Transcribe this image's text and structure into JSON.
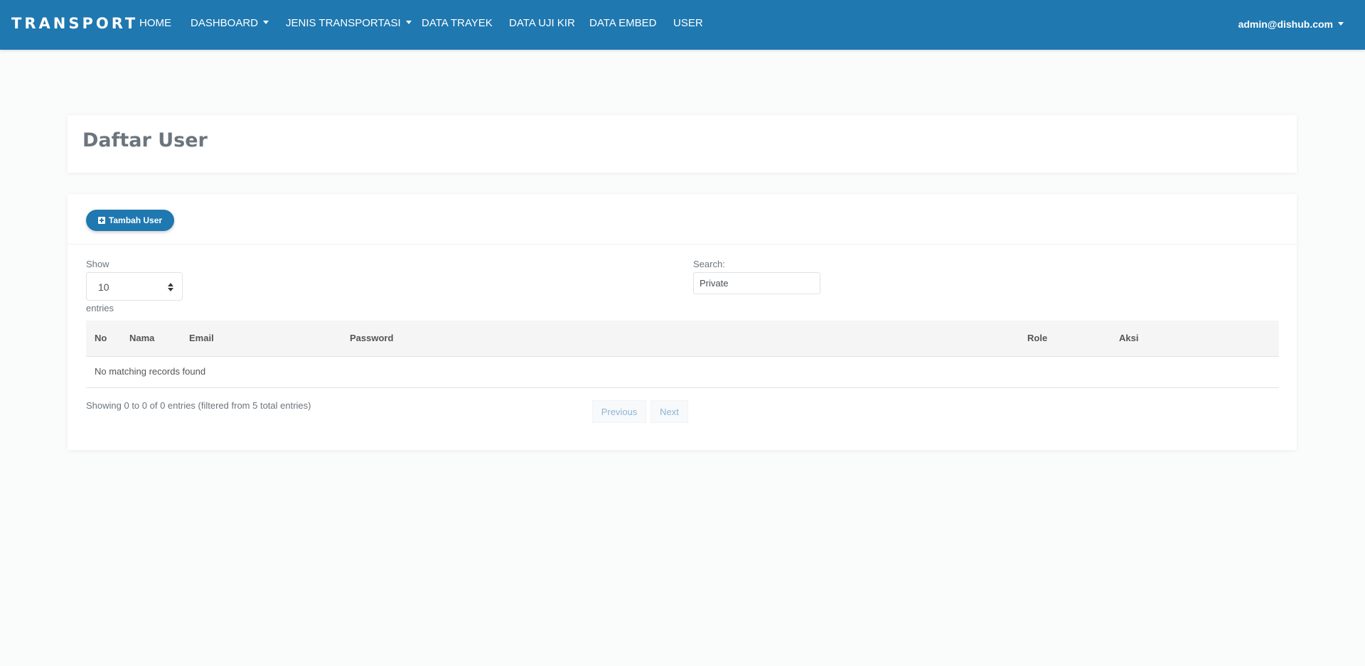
{
  "navbar": {
    "brand": "TRANSPORT",
    "items": [
      {
        "label": "HOME",
        "dropdown": false
      },
      {
        "label": "DASHBOARD",
        "dropdown": true
      },
      {
        "label": "JENIS TRANSPORTASI",
        "dropdown": true
      },
      {
        "label": "DATA TRAYEK",
        "dropdown": false
      },
      {
        "label": "DATA UJI KIR",
        "dropdown": false
      },
      {
        "label": "DATA EMBED",
        "dropdown": false
      },
      {
        "label": "USER",
        "dropdown": false
      }
    ],
    "user_email": "admin@dishub.com",
    "color": "#1f78b0"
  },
  "page": {
    "title": "Daftar User"
  },
  "toolbar": {
    "add_label": "Tambah User",
    "add_icon": "plus-square-icon"
  },
  "table_controls": {
    "show_label": "Show",
    "page_size": "10",
    "entries_label": "entries",
    "search_label": "Search:",
    "search_value": "Private"
  },
  "table": {
    "columns": [
      "No",
      "Nama",
      "Email",
      "Password",
      "Role",
      "Aksi"
    ],
    "rows": [],
    "empty_message": "No matching records found"
  },
  "footer": {
    "info": "Showing 0 to 0 of 0 entries (filtered from 5 total entries)",
    "prev_label": "Previous",
    "next_label": "Next"
  }
}
